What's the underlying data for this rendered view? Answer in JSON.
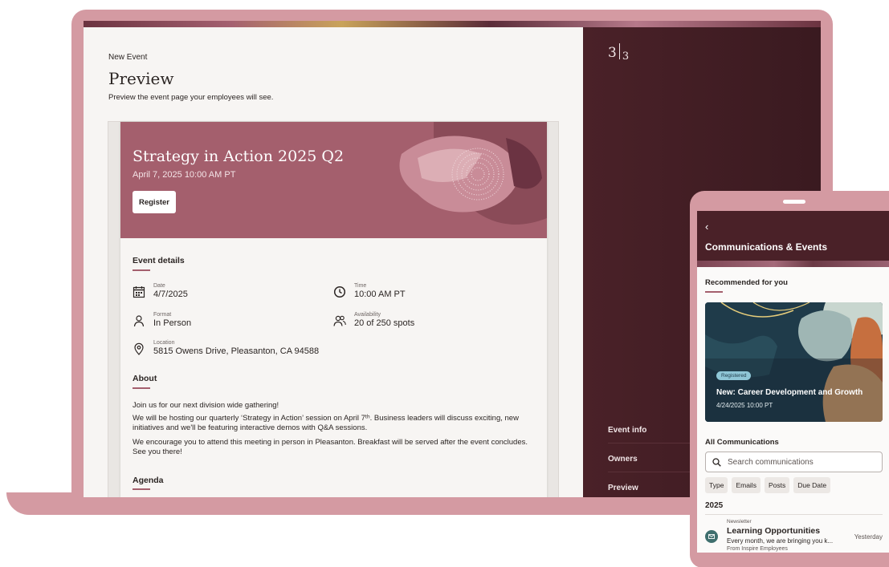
{
  "preview": {
    "breadcrumb": "New Event",
    "title": "Preview",
    "subtitle": "Preview the event page your employees will see."
  },
  "event": {
    "title": "Strategy in Action 2025 Q2",
    "datetime": "April 7, 2025 10:00 AM PT",
    "register_label": "Register",
    "details_heading": "Event details",
    "date_label": "Date",
    "date_value": "4/7/2025",
    "time_label": "Time",
    "time_value": "10:00 AM PT",
    "format_label": "Format",
    "format_value": "In Person",
    "availability_label": "Availability",
    "availability_value": "20 of 250 spots",
    "location_label": "Location",
    "location_value": "5815 Owens Drive, Pleasanton, CA 94588",
    "about_heading": "About",
    "about_p1": "Join us for our next division wide gathering!",
    "about_p2": "We will be hosting our quarterly ‘Strategy in Action’ session on April 7ᵗʰ. Business leaders will discuss exciting, new initiatives and we'll be featuring interactive demos with Q&A sessions.",
    "about_p3": "We encourage you to attend this meeting in person in Pleasanton. Breakfast will be served after the event concludes. See you there!",
    "agenda_heading": "Agenda"
  },
  "side_nav": {
    "logo_main": "3",
    "logo_sub": "3",
    "items": [
      "Event info",
      "Owners",
      "Preview"
    ]
  },
  "phone": {
    "back": "‹",
    "title": "Communications & Events",
    "recommended_heading": "Recommended for you",
    "promo": {
      "badge": "Registered",
      "title": "New: Career Development and Growth",
      "date": "4/24/2025 10:00 PT"
    },
    "all_heading": "All Communications",
    "search_placeholder": "Search communications",
    "chips": [
      "Type",
      "Emails",
      "Posts",
      "Due Date"
    ],
    "year": "2025",
    "item": {
      "kicker": "Newsletter",
      "title": "Learning Opportunities",
      "desc": "Every month, we are bringing you k...",
      "from": "From Inspire Employees",
      "time": "Yesterday"
    }
  },
  "colors": {
    "brand_rose": "#a45f6d",
    "frame_pink": "#d49aa2",
    "side_dark": "#4a2128",
    "promo_navy": "#1f3b4a"
  }
}
